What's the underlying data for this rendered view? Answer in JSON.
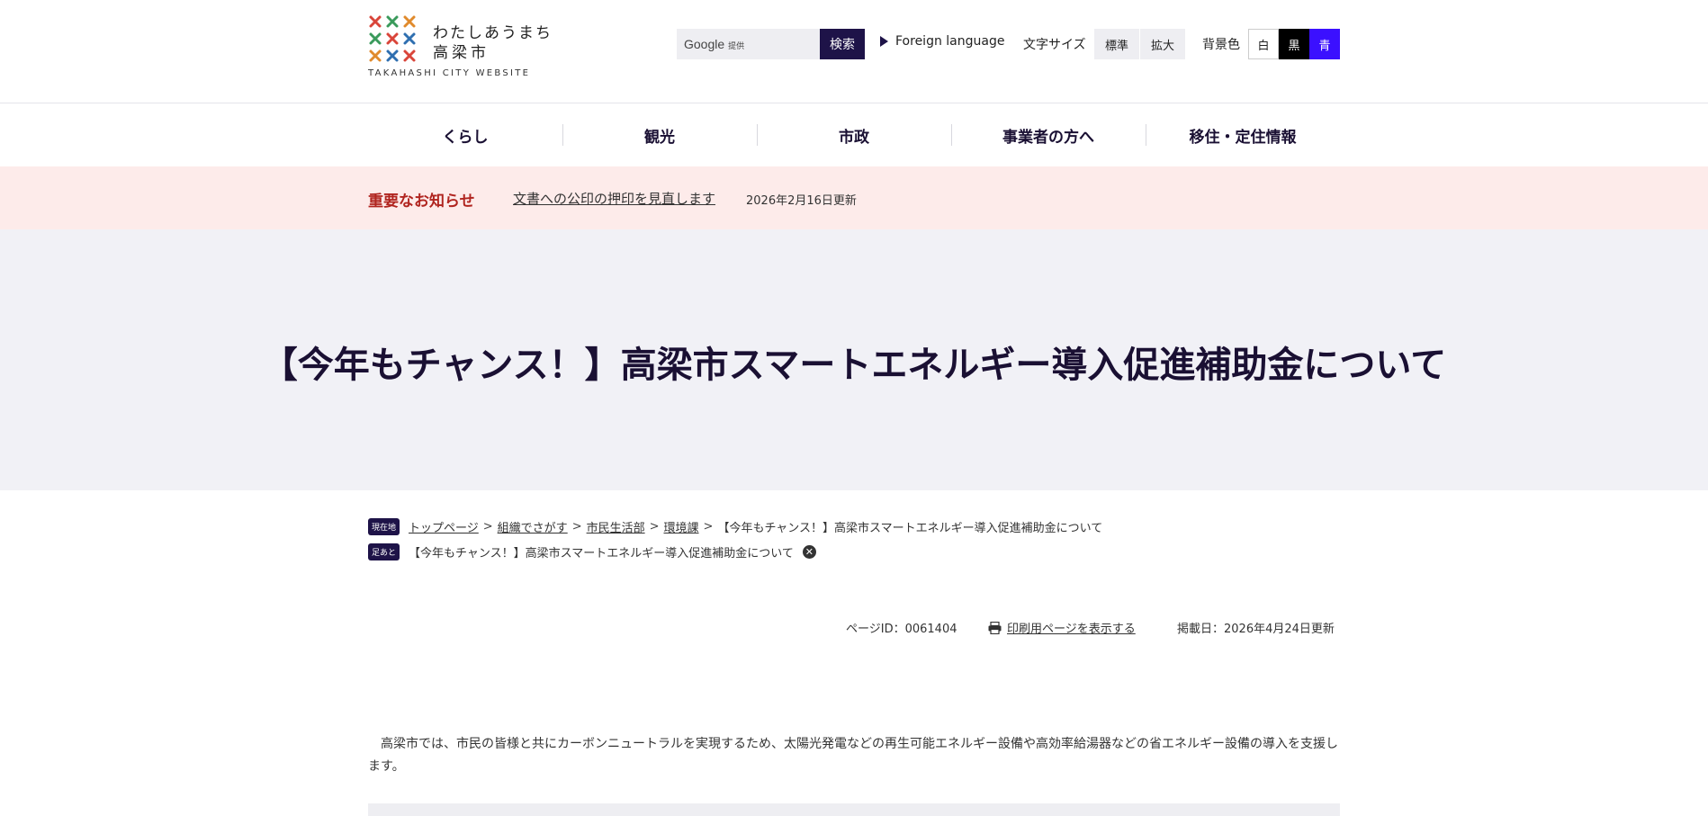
{
  "header": {
    "logo_line1": "わたしあうまち",
    "logo_line2": "高梁市",
    "logo_sub": "TAKAHASHI CITY WEBSITE",
    "search_brand": "Google",
    "search_brand_note": "提供",
    "search_button": "検索",
    "foreign_language": "Foreign language",
    "font_size_label": "文字サイズ",
    "font_size_standard": "標準",
    "font_size_large": "拡大",
    "bg_color_label": "背景色",
    "bg_white": "白",
    "bg_black": "黒",
    "bg_blue": "青"
  },
  "nav": {
    "items": [
      {
        "label": "くらし"
      },
      {
        "label": "観光"
      },
      {
        "label": "市政"
      },
      {
        "label": "事業者の方へ"
      },
      {
        "label": "移住・定住情報"
      }
    ]
  },
  "notice": {
    "label": "重要なお知らせ",
    "link": "文書への公印の押印を見直します",
    "date": "2026年2月16日更新"
  },
  "page": {
    "title": "【今年もチャンス！】高梁市スマートエネルギー導入促進補助金について"
  },
  "breadcrumb": {
    "current_tag": "現在地",
    "items": [
      "トップページ",
      "組織でさがす",
      "市民生活部",
      "環境課"
    ],
    "current": "【今年もチャンス！】高梁市スマートエネルギー導入促進補助金について",
    "footprint_tag": "足あと",
    "footprint": "【今年もチャンス！】高梁市スマートエネルギー導入促進補助金について"
  },
  "meta": {
    "page_id": "ページID：0061404",
    "print_link": "印刷用ページを表示する",
    "published": "掲載日：2026年4月24日更新"
  },
  "body": {
    "paragraph": "　高梁市では、市民の皆様と共にカーボンニュートラルを実現するため、太陽光発電などの再生可能エネルギー設備や高効率給湯器などの省エネルギー設備の導入を支援します。"
  },
  "colors": {
    "brand_navy": "#1e1348",
    "notice_bg": "#fdebea",
    "notice_red": "#b0241f",
    "title_band": "#f1f1f6",
    "bg_blue_button": "#3b10ff"
  }
}
